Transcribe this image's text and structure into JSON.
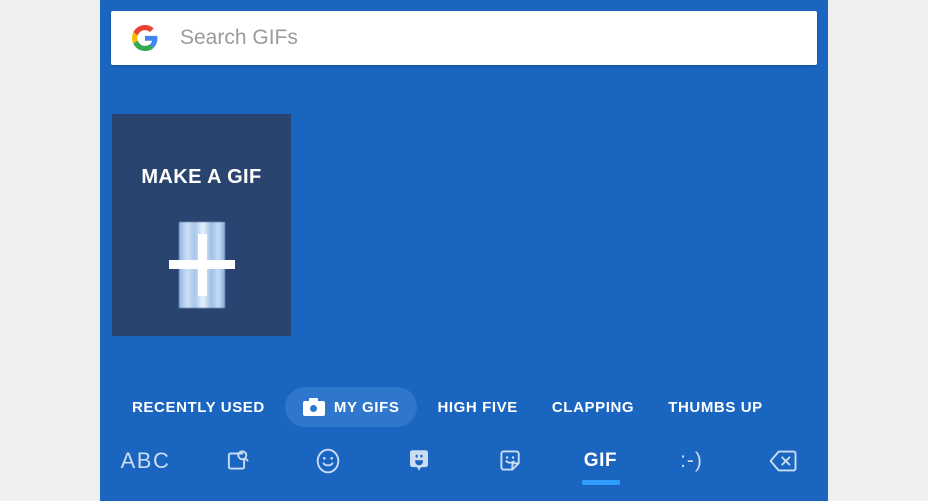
{
  "app": {
    "name": "Gboard GIF Keyboard",
    "panel_color": "#1965c0",
    "page_background": "#efefef"
  },
  "search": {
    "placeholder": "Search GIFs",
    "value": "",
    "logo_icon": "google-g-icon",
    "background": "#ffffff",
    "placeholder_color": "#9b9b9b"
  },
  "make_gif": {
    "label": "MAKE A GIF",
    "icon": "plus-icon",
    "tile_color": "#2a4470",
    "label_color": "#ffffff"
  },
  "categories": {
    "selected": "MY GIFS",
    "selected_pill_color": "#2f76cd",
    "items": [
      {
        "label": "RECENTLY USED",
        "icon": null,
        "selected": false
      },
      {
        "label": "MY GIFS",
        "icon": "camera-icon",
        "selected": true
      },
      {
        "label": "HIGH FIVE",
        "icon": null,
        "selected": false
      },
      {
        "label": "CLAPPING",
        "icon": null,
        "selected": false
      },
      {
        "label": "THUMBS UP",
        "icon": null,
        "selected": false
      }
    ]
  },
  "bottom_bar": {
    "active": "GIF",
    "active_underline_color": "#2e9bff",
    "icon_color": "#ccdcf2",
    "items": [
      {
        "id": "abc",
        "label": "ABC",
        "icon": "abc-text-icon",
        "type": "text",
        "active": false
      },
      {
        "id": "search",
        "label": "",
        "icon": "sticker-search-icon",
        "type": "svg",
        "active": false
      },
      {
        "id": "emoji",
        "label": "",
        "icon": "smiley-face-icon",
        "type": "svg",
        "active": false
      },
      {
        "id": "bitmoji",
        "label": "",
        "icon": "bitmoji-bubble-icon",
        "type": "svg",
        "active": false
      },
      {
        "id": "sticker",
        "label": "",
        "icon": "sticker-icon",
        "type": "svg",
        "active": false
      },
      {
        "id": "gif",
        "label": "GIF",
        "icon": "gif-text-icon",
        "type": "text",
        "active": true
      },
      {
        "id": "emoticon",
        "label": ":-)",
        "icon": "emoticon-icon",
        "type": "text",
        "active": false
      },
      {
        "id": "backspace",
        "label": "",
        "icon": "backspace-icon",
        "type": "svg",
        "active": false
      }
    ]
  }
}
